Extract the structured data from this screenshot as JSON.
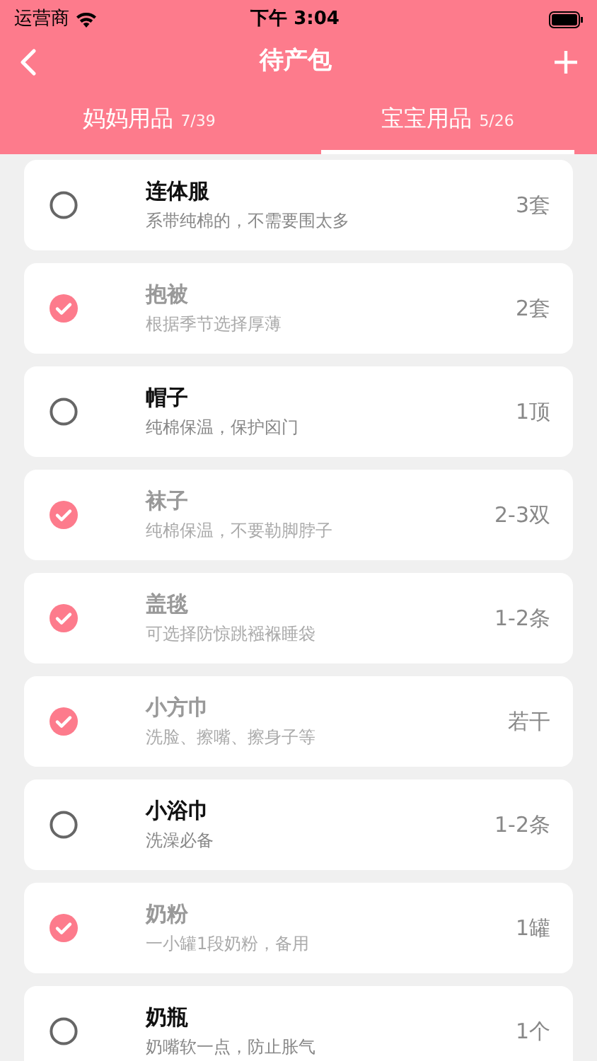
{
  "status_bar": {
    "carrier": "运营商",
    "time": "下午 3:04"
  },
  "nav": {
    "title": "待产包"
  },
  "tabs": [
    {
      "label": "妈妈用品",
      "count": "7/39",
      "selected": false
    },
    {
      "label": "宝宝用品",
      "count": "5/26",
      "selected": true
    }
  ],
  "items": [
    {
      "name": "连体服",
      "note": "系带纯棉的，不需要围太多",
      "quantity": "3套",
      "checked": false
    },
    {
      "name": "抱被",
      "note": "根据季节选择厚薄",
      "quantity": "2套",
      "checked": true
    },
    {
      "name": "帽子",
      "note": "纯棉保温，保护囟门",
      "quantity": "1顶",
      "checked": false
    },
    {
      "name": "袜子",
      "note": "纯棉保温，不要勒脚脖子",
      "quantity": "2-3双",
      "checked": true
    },
    {
      "name": "盖毯",
      "note": "可选择防惊跳襁褓睡袋",
      "quantity": "1-2条",
      "checked": true
    },
    {
      "name": "小方巾",
      "note": "洗脸、擦嘴、擦身子等",
      "quantity": "若干",
      "checked": true
    },
    {
      "name": "小浴巾",
      "note": "洗澡必备",
      "quantity": "1-2条",
      "checked": false
    },
    {
      "name": "奶粉",
      "note": "一小罐1段奶粉，备用",
      "quantity": "1罐",
      "checked": true
    },
    {
      "name": "奶瓶",
      "note": "奶嘴软一点，防止胀气",
      "quantity": "1个",
      "checked": false
    }
  ]
}
